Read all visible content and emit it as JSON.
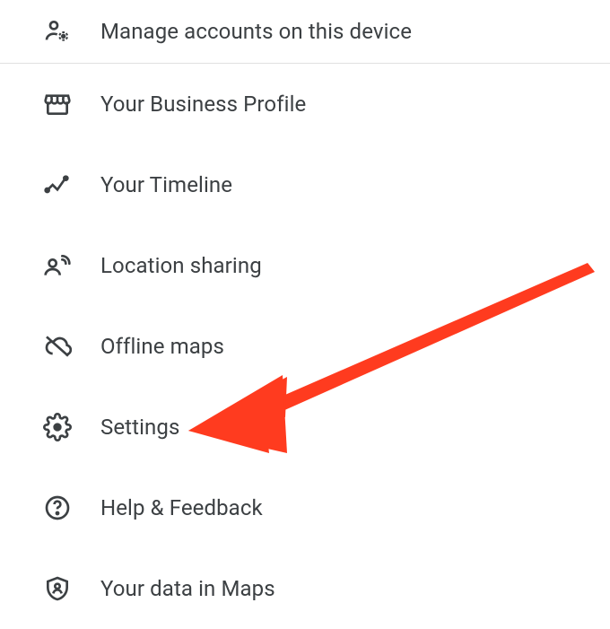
{
  "menu": {
    "items": [
      {
        "label": "Manage accounts on this device"
      },
      {
        "label": "Your Business Profile"
      },
      {
        "label": "Your Timeline"
      },
      {
        "label": "Location sharing"
      },
      {
        "label": "Offline maps"
      },
      {
        "label": "Settings"
      },
      {
        "label": "Help & Feedback"
      },
      {
        "label": "Your data in Maps"
      }
    ]
  },
  "annotation": {
    "arrow_color": "#FF3B1F"
  }
}
